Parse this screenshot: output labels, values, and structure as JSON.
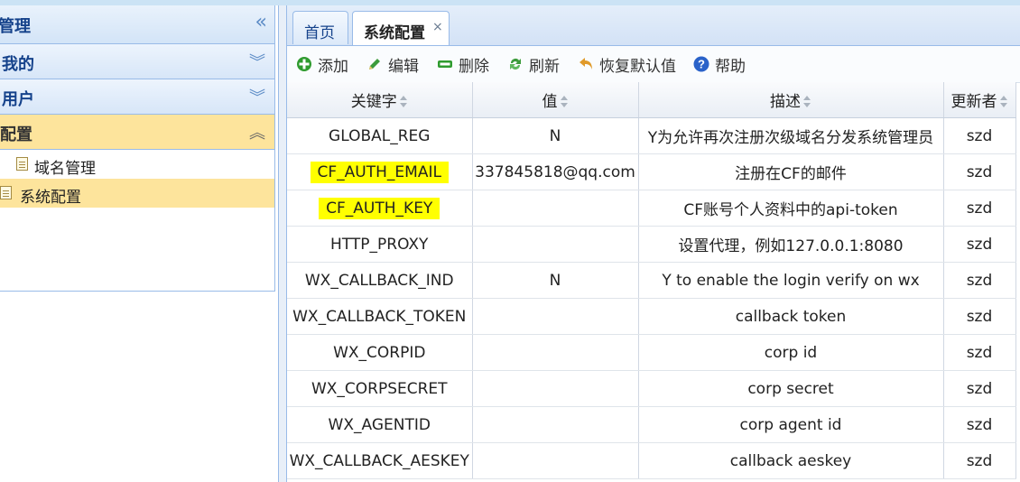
{
  "nav": {
    "title": "管理",
    "sections": [
      {
        "label": "我的",
        "expanded": false
      },
      {
        "label": "用户",
        "expanded": false
      },
      {
        "label": "配置",
        "expanded": true
      }
    ],
    "items": [
      {
        "label": "域名管理",
        "selected": false
      },
      {
        "label": "系统配置",
        "selected": true
      }
    ]
  },
  "tabs": [
    {
      "label": "首页",
      "active": false
    },
    {
      "label": "系统配置",
      "active": true,
      "close": "×"
    }
  ],
  "toolbar": {
    "add": "添加",
    "edit": "编辑",
    "delete": "删除",
    "refresh": "刷新",
    "restore": "恢复默认值",
    "help": "帮助"
  },
  "grid": {
    "columns": [
      "关键字",
      "值",
      "描述",
      "更新者"
    ],
    "rows": [
      {
        "key": "GLOBAL_REG",
        "value": "N",
        "desc": "Y为允许再次注册次级域名分发系统管理员",
        "updater": "szd"
      },
      {
        "key": "CF_AUTH_EMAIL",
        "value": "337845818@qq.com",
        "desc": "注册在CF的邮件",
        "updater": "szd",
        "highlight": true
      },
      {
        "key": "CF_AUTH_KEY",
        "value": "",
        "desc": "CF账号个人资料中的api-token",
        "updater": "szd",
        "highlight": true
      },
      {
        "key": "HTTP_PROXY",
        "value": "",
        "desc": "设置代理，例如127.0.0.1:8080",
        "updater": "szd"
      },
      {
        "key": "WX_CALLBACK_IND",
        "value": "N",
        "desc": "Y to enable the login verify on wx",
        "updater": "szd"
      },
      {
        "key": "WX_CALLBACK_TOKEN",
        "value": "",
        "desc": "callback token",
        "updater": "szd"
      },
      {
        "key": "WX_CORPID",
        "value": "",
        "desc": "corp id",
        "updater": "szd"
      },
      {
        "key": "WX_CORPSECRET",
        "value": "",
        "desc": "corp secret",
        "updater": "szd"
      },
      {
        "key": "WX_AGENTID",
        "value": "",
        "desc": "corp agent id",
        "updater": "szd"
      },
      {
        "key": "WX_CALLBACK_AESKEY",
        "value": "",
        "desc": "callback aeskey",
        "updater": "szd"
      }
    ]
  },
  "colors": {
    "highlight": "#ffff00",
    "selected": "#fde49c",
    "header_text": "#15428b"
  }
}
